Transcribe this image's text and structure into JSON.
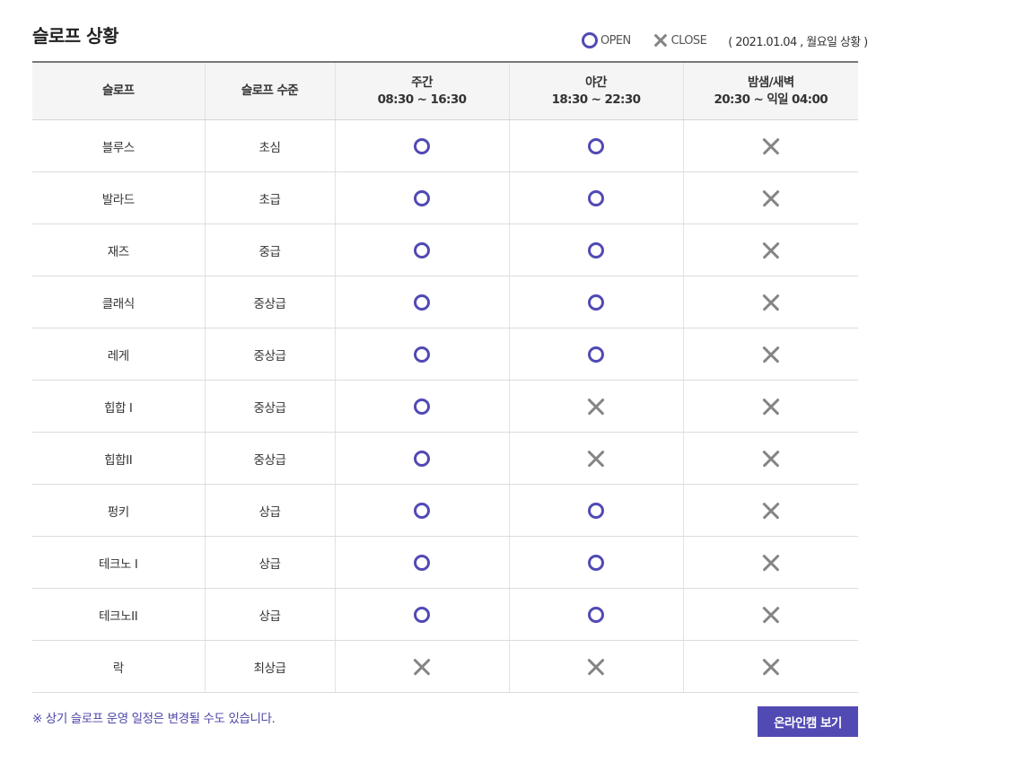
{
  "title": "슬로프 상황",
  "legend": {
    "open_label": "OPEN",
    "close_label": "CLOSE",
    "date_note": "( 2021.01.04 , 월요일 상황 )"
  },
  "table": {
    "headers": [
      {
        "line1": "슬로프",
        "line2": ""
      },
      {
        "line1": "슬로프 수준",
        "line2": ""
      },
      {
        "line1": "주간",
        "line2": "08:30 ~ 16:30"
      },
      {
        "line1": "야간",
        "line2": "18:30 ~ 22:30"
      },
      {
        "line1": "밤샘/새벽",
        "line2": "20:30 ~ 익일 04:00"
      }
    ],
    "rows": [
      {
        "slope": "블루스",
        "level": "초심",
        "day": "open",
        "night": "open",
        "dawn": "close"
      },
      {
        "slope": "발라드",
        "level": "초급",
        "day": "open",
        "night": "open",
        "dawn": "close"
      },
      {
        "slope": "재즈",
        "level": "중급",
        "day": "open",
        "night": "open",
        "dawn": "close"
      },
      {
        "slope": "클래식",
        "level": "중상급",
        "day": "open",
        "night": "open",
        "dawn": "close"
      },
      {
        "slope": "레게",
        "level": "중상급",
        "day": "open",
        "night": "open",
        "dawn": "close"
      },
      {
        "slope": "힙합 I",
        "level": "중상급",
        "day": "open",
        "night": "close",
        "dawn": "close"
      },
      {
        "slope": "힙합II",
        "level": "중상급",
        "day": "open",
        "night": "close",
        "dawn": "close"
      },
      {
        "slope": "펑키",
        "level": "상급",
        "day": "open",
        "night": "open",
        "dawn": "close"
      },
      {
        "slope": "테크노 I",
        "level": "상급",
        "day": "open",
        "night": "open",
        "dawn": "close"
      },
      {
        "slope": "테크노II",
        "level": "상급",
        "day": "open",
        "night": "open",
        "dawn": "close"
      },
      {
        "slope": "락",
        "level": "최상급",
        "day": "close",
        "night": "close",
        "dawn": "close"
      }
    ]
  },
  "footer": {
    "note": "※ 상기 슬로프 운영 일정은 변경될 수도 있습니다.",
    "cam_button": "온라인캠 보기"
  },
  "colors": {
    "open": "#514ab3",
    "close": "#858585",
    "button": "#514ab3",
    "note": "#4c46a8"
  },
  "icons": {
    "open": "open-circle-icon",
    "close": "close-x-icon"
  }
}
